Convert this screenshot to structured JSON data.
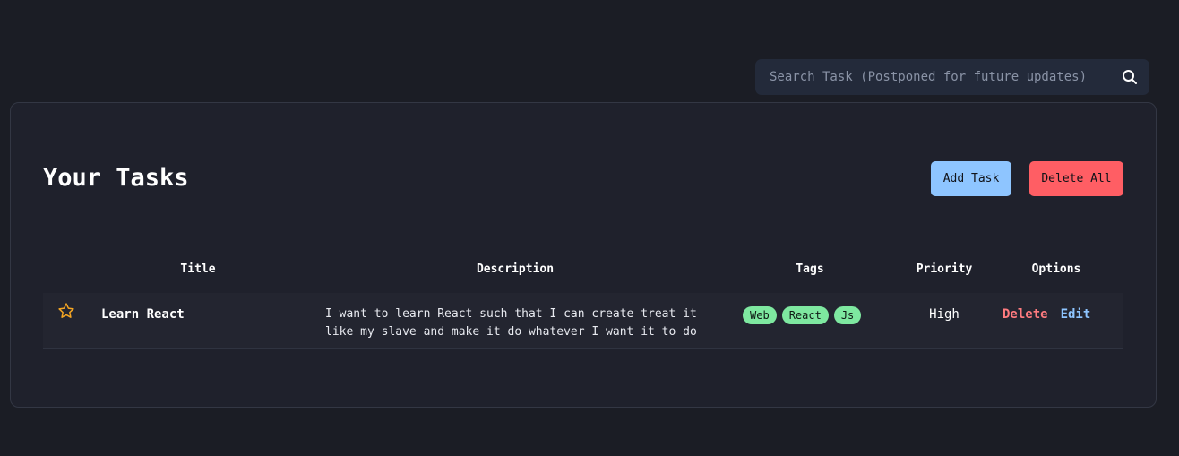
{
  "search": {
    "placeholder": "Search Task (Postponed for future updates)",
    "icon": "search-icon"
  },
  "header": {
    "title": "Your Tasks",
    "add_label": "Add Task",
    "delete_all_label": "Delete All"
  },
  "colors": {
    "background": "#1b1d25",
    "panel": "#1f212c",
    "add_button": "#8ec5ff",
    "delete_button": "#ff5e64",
    "tag": "#7ee8a0",
    "star": "#f5a623",
    "option_delete": "#ff7b7f",
    "option_edit": "#8ec5ff"
  },
  "table": {
    "columns": [
      "Title",
      "Description",
      "Tags",
      "Priority",
      "Options"
    ],
    "rows": [
      {
        "starred": false,
        "star_icon": "star-outline-icon",
        "title": "Learn React",
        "description": "I want to learn React such that I can create treat it like my slave and make it do whatever I want it to do",
        "tags": [
          "Web",
          "React",
          "Js"
        ],
        "priority": "High",
        "options": {
          "delete": "Delete",
          "edit": "Edit"
        }
      }
    ]
  }
}
